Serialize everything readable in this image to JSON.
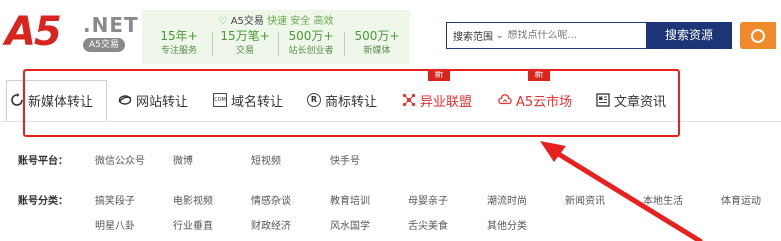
{
  "header": {
    "logo": {
      "main": "A5",
      "net": ".NET",
      "badge": "A5交易"
    },
    "stats": {
      "title_brand": "A5交易",
      "title_tagline": "快速 安全 高效",
      "items": [
        {
          "num": "15年+",
          "label": "专注服务"
        },
        {
          "num": "15万笔+",
          "label": "交易"
        },
        {
          "num": "500万+",
          "label": "站长创业者"
        },
        {
          "num": "500万+",
          "label": "新媒体"
        }
      ]
    },
    "search": {
      "scope_label": "搜索范围",
      "placeholder": "想找点什么呢...",
      "button_label": "搜索资源"
    }
  },
  "nav": {
    "items": [
      {
        "label": "新媒体转让",
        "icon": "refresh-icon"
      },
      {
        "label": "网站转让",
        "icon": "globe-icon"
      },
      {
        "label": "域名转让",
        "icon": "domain-com-icon"
      },
      {
        "label": "商标转让",
        "icon": "registered-trademark-icon"
      },
      {
        "label": "异业联盟",
        "icon": "alliance-icon",
        "badge": "新"
      },
      {
        "label": "A5云市场",
        "icon": "cloud-icon",
        "badge": "新"
      },
      {
        "label": "文章资讯",
        "icon": "article-icon"
      }
    ]
  },
  "platform": {
    "label": "账号平台：",
    "items": [
      "微信公众号",
      "微博",
      "短视频",
      "快手号"
    ]
  },
  "category": {
    "label": "账号分类：",
    "row1": [
      "搞笑段子",
      "电影视频",
      "情感杂谈",
      "教育培训",
      "母婴亲子",
      "潮流时尚",
      "新闻资讯",
      "本地生活",
      "体育运动"
    ],
    "row2": [
      "明星八卦",
      "行业垂直",
      "财政经济",
      "风水国学",
      "舌尖美食",
      "其他分类"
    ]
  },
  "colors": {
    "brand_red": "#d9251d",
    "navy": "#1b3577",
    "highlight_red": "#e8201e",
    "stats_green": "#4a9a36",
    "orange": "#f0892a"
  }
}
